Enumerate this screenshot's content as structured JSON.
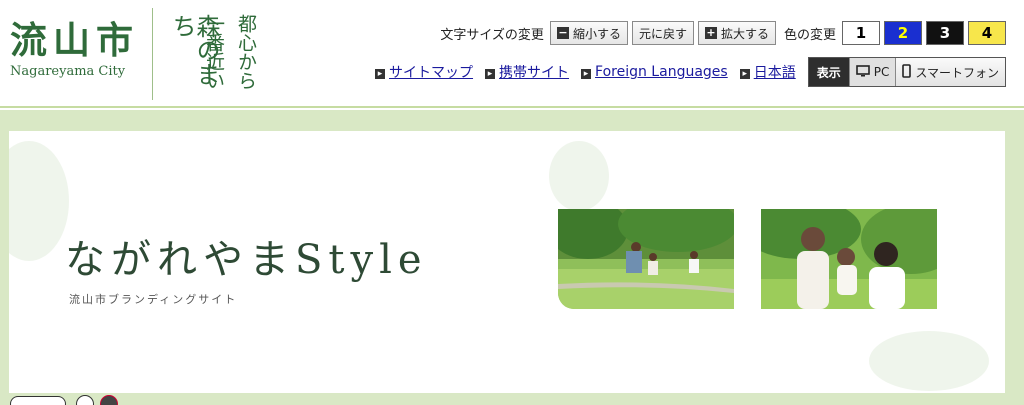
{
  "logo": {
    "kanji": "流山市",
    "en": "Nagareyama City"
  },
  "catch": {
    "c1": "森のまち",
    "c2": "一番近い",
    "c3": "都心から"
  },
  "text_size": {
    "label": "文字サイズの変更",
    "shrink": "縮小する",
    "reset": "元に戻す",
    "enlarge": "拡大する"
  },
  "color_change": {
    "label": "色の変更",
    "options": [
      {
        "label": "1",
        "bg": "#ffffff",
        "fg": "#000000"
      },
      {
        "label": "2",
        "bg": "#1a2fd0",
        "fg": "#ffff00"
      },
      {
        "label": "3",
        "bg": "#111111",
        "fg": "#ffffff"
      },
      {
        "label": "4",
        "bg": "#f7e64b",
        "fg": "#000000"
      }
    ]
  },
  "links": {
    "sitemap": "サイトマップ",
    "mobile": "携帯サイト",
    "foreign": "Foreign Languages",
    "japanese": "日本語"
  },
  "display": {
    "label": "表示",
    "pc": "PC",
    "smartphone": "スマートフォン"
  },
  "banner": {
    "title": "ながれやまStyle",
    "subtitle": "流山市ブランディングサイト"
  },
  "colors": {
    "brand_green": "#2f6b3a",
    "main_bg": "#d9e8c5"
  }
}
